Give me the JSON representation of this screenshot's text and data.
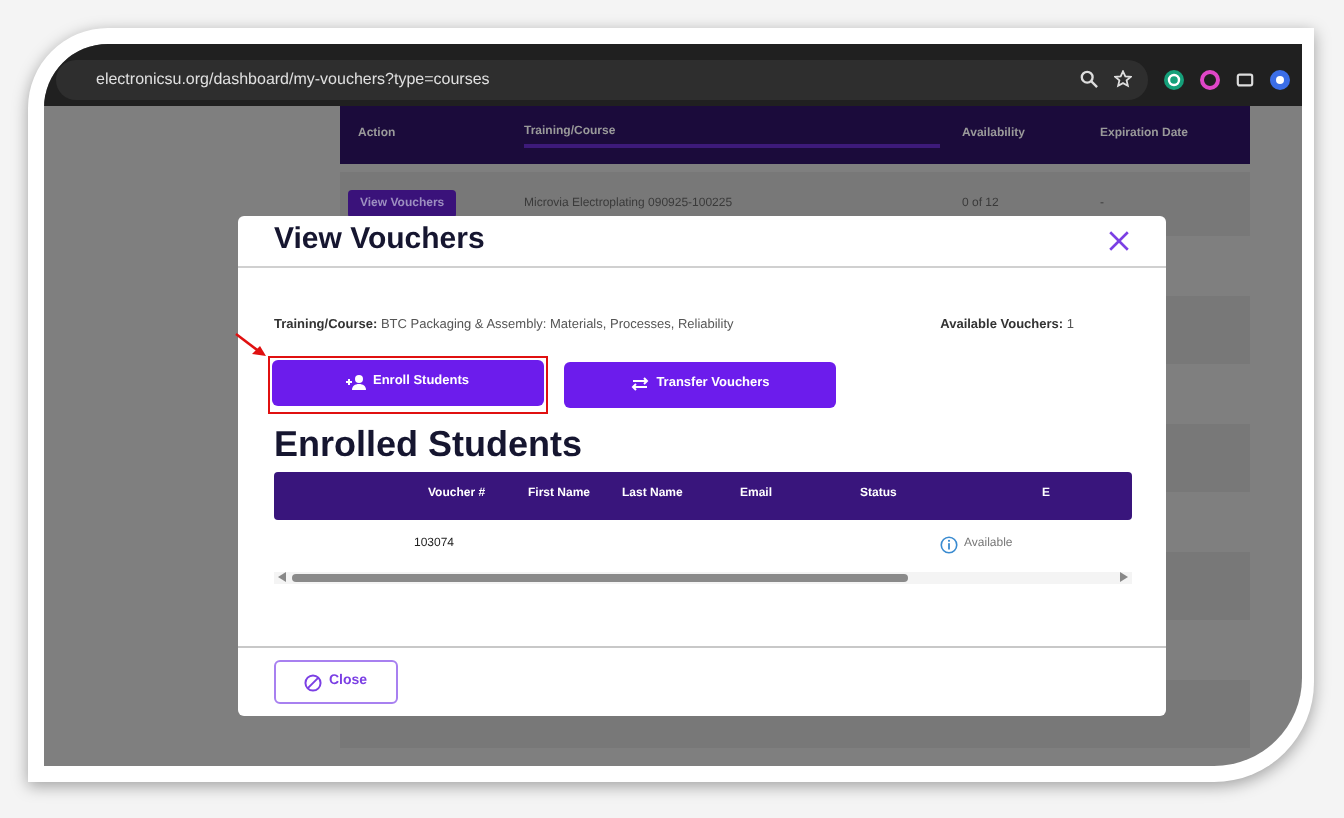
{
  "browser": {
    "url": "electronicsu.org/dashboard/my-vouchers?type=courses"
  },
  "background_table": {
    "columns": [
      "Action",
      "Training/Course",
      "Availability",
      "Expiration Date"
    ],
    "rows": [
      {
        "action": "View Vouchers",
        "course": "Microvia Electroplating 090925-100225",
        "availability": "0 of 12",
        "expiration": "-"
      }
    ]
  },
  "modal": {
    "title": "View Vouchers",
    "course_label": "Training/Course:",
    "course": "BTC Packaging & Assembly: Materials, Processes, Reliability",
    "available_label": "Available Vouchers:",
    "available": "1",
    "buttons": [
      {
        "label": "Enroll Students",
        "kind": "enroll",
        "highlighted": true
      },
      {
        "label": "Transfer Vouchers",
        "kind": "transfer",
        "highlighted": false
      }
    ],
    "section_title": "Enrolled Students",
    "table": {
      "columns": [
        "Voucher #",
        "First Name",
        "Last Name",
        "Email",
        "Status",
        "E"
      ],
      "rows": [
        {
          "voucher": "103074",
          "status": "Available"
        }
      ]
    },
    "close_button": "Close"
  }
}
